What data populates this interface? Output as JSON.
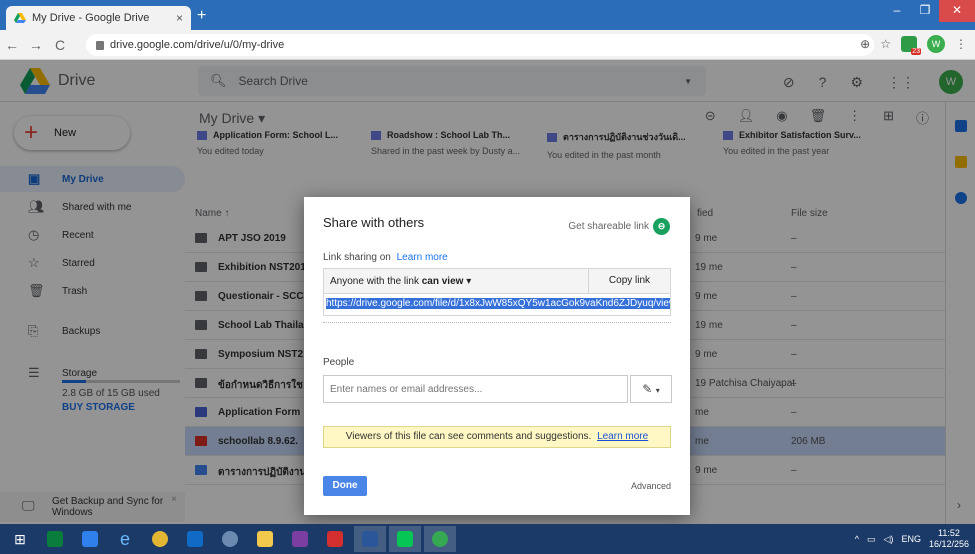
{
  "browser": {
    "tab_title": "My Drive - Google Drive",
    "tab_close": "×",
    "new_tab": "+",
    "url": "drive.google.com/drive/u/0/my-drive",
    "profile_initial": "W",
    "ext_badge": "23"
  },
  "drive": {
    "brand": "Drive",
    "search_placeholder": "Search Drive",
    "user_initial": "W",
    "new_label": "New",
    "breadcrumb": "My Drive",
    "sidebar": {
      "items": [
        {
          "label": "My Drive"
        },
        {
          "label": "Shared with me"
        },
        {
          "label": "Recent"
        },
        {
          "label": "Starred"
        },
        {
          "label": "Trash"
        },
        {
          "label": "Backups"
        },
        {
          "label": "Storage"
        }
      ],
      "storage_used": "2.8 GB of 15 GB used",
      "buy_storage": "BUY STORAGE",
      "backup_line1": "Get Backup and Sync for",
      "backup_line2": "Windows"
    },
    "quick_access": [
      {
        "title": "Application Form: School L...",
        "subtitle": "You edited today"
      },
      {
        "title": "Roadshow : School Lab Th...",
        "subtitle": "Shared in the past week by Dusty a..."
      },
      {
        "title": "ตารางการปฏิบัติงานช่วงวันเดิ...",
        "subtitle": "You edited in the past month"
      },
      {
        "title": "Exhibitor Satisfaction Surv...",
        "subtitle": "You edited in the past year"
      }
    ],
    "columns": {
      "name": "Name",
      "sort_arrow": "↑",
      "modified": "fied",
      "size": "File size"
    },
    "rows": [
      {
        "name": "APT JSO 2019",
        "modified": "9 me",
        "size": "–"
      },
      {
        "name": "Exhibition NST201",
        "modified": "19 me",
        "size": "–"
      },
      {
        "name": "Questionair - SCC",
        "modified": "9 me",
        "size": "–"
      },
      {
        "name": "School Lab Thaila",
        "modified": "19 me",
        "size": "–"
      },
      {
        "name": "Symposium NST2",
        "modified": "9 me",
        "size": "–"
      },
      {
        "name": "ข้อกำหนดวิธีการใช",
        "modified": "19 Patchisa Chaiyapat",
        "size": "–"
      },
      {
        "name": "Application Form",
        "modified": "me",
        "size": "–"
      },
      {
        "name": "schoollab 8.9.62.",
        "modified": "me",
        "size": "206 MB"
      },
      {
        "name": "ตารางการปฏิบัติงาน",
        "modified": "9 me",
        "size": "–"
      }
    ]
  },
  "dialog": {
    "title": "Share with others",
    "get_link": "Get shareable link",
    "link_sharing_on": "Link sharing on",
    "learn_more": "Learn more",
    "perm_prefix": "Anyone with the link",
    "perm_bold": "can view",
    "copy_link": "Copy link",
    "url": "https://drive.google.com/file/d/1x8xJwW85xQY5w1acGok9vaKnd6ZJDyuq/view?usp",
    "people_label": "People",
    "people_placeholder": "Enter names or email addresses...",
    "notice": "Viewers of this file can see comments and suggestions.",
    "notice_link": "Learn more",
    "done": "Done",
    "advanced": "Advanced"
  },
  "taskbar": {
    "lang": "ENG",
    "time": "11:52",
    "date": "16/12/256"
  },
  "colors": {
    "accent": "#1a73e8",
    "done_button": "#4a86e8",
    "selection": "#3470d8",
    "notice_bg": "#fff8c4",
    "taskbar": "#1b3a67",
    "tabstrip": "#2b6db8"
  }
}
